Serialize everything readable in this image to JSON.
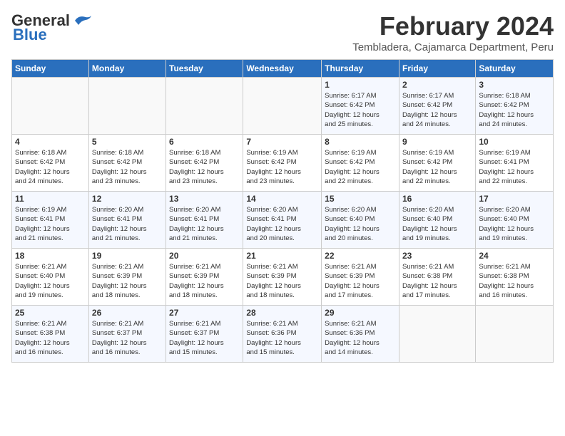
{
  "header": {
    "logo_general": "General",
    "logo_blue": "Blue",
    "month": "February 2024",
    "location": "Tembladera, Cajamarca Department, Peru"
  },
  "days_of_week": [
    "Sunday",
    "Monday",
    "Tuesday",
    "Wednesday",
    "Thursday",
    "Friday",
    "Saturday"
  ],
  "weeks": [
    [
      {
        "day": "",
        "info": ""
      },
      {
        "day": "",
        "info": ""
      },
      {
        "day": "",
        "info": ""
      },
      {
        "day": "",
        "info": ""
      },
      {
        "day": "1",
        "info": "Sunrise: 6:17 AM\nSunset: 6:42 PM\nDaylight: 12 hours\nand 25 minutes."
      },
      {
        "day": "2",
        "info": "Sunrise: 6:17 AM\nSunset: 6:42 PM\nDaylight: 12 hours\nand 24 minutes."
      },
      {
        "day": "3",
        "info": "Sunrise: 6:18 AM\nSunset: 6:42 PM\nDaylight: 12 hours\nand 24 minutes."
      }
    ],
    [
      {
        "day": "4",
        "info": "Sunrise: 6:18 AM\nSunset: 6:42 PM\nDaylight: 12 hours\nand 24 minutes."
      },
      {
        "day": "5",
        "info": "Sunrise: 6:18 AM\nSunset: 6:42 PM\nDaylight: 12 hours\nand 23 minutes."
      },
      {
        "day": "6",
        "info": "Sunrise: 6:18 AM\nSunset: 6:42 PM\nDaylight: 12 hours\nand 23 minutes."
      },
      {
        "day": "7",
        "info": "Sunrise: 6:19 AM\nSunset: 6:42 PM\nDaylight: 12 hours\nand 23 minutes."
      },
      {
        "day": "8",
        "info": "Sunrise: 6:19 AM\nSunset: 6:42 PM\nDaylight: 12 hours\nand 22 minutes."
      },
      {
        "day": "9",
        "info": "Sunrise: 6:19 AM\nSunset: 6:42 PM\nDaylight: 12 hours\nand 22 minutes."
      },
      {
        "day": "10",
        "info": "Sunrise: 6:19 AM\nSunset: 6:41 PM\nDaylight: 12 hours\nand 22 minutes."
      }
    ],
    [
      {
        "day": "11",
        "info": "Sunrise: 6:19 AM\nSunset: 6:41 PM\nDaylight: 12 hours\nand 21 minutes."
      },
      {
        "day": "12",
        "info": "Sunrise: 6:20 AM\nSunset: 6:41 PM\nDaylight: 12 hours\nand 21 minutes."
      },
      {
        "day": "13",
        "info": "Sunrise: 6:20 AM\nSunset: 6:41 PM\nDaylight: 12 hours\nand 21 minutes."
      },
      {
        "day": "14",
        "info": "Sunrise: 6:20 AM\nSunset: 6:41 PM\nDaylight: 12 hours\nand 20 minutes."
      },
      {
        "day": "15",
        "info": "Sunrise: 6:20 AM\nSunset: 6:40 PM\nDaylight: 12 hours\nand 20 minutes."
      },
      {
        "day": "16",
        "info": "Sunrise: 6:20 AM\nSunset: 6:40 PM\nDaylight: 12 hours\nand 19 minutes."
      },
      {
        "day": "17",
        "info": "Sunrise: 6:20 AM\nSunset: 6:40 PM\nDaylight: 12 hours\nand 19 minutes."
      }
    ],
    [
      {
        "day": "18",
        "info": "Sunrise: 6:21 AM\nSunset: 6:40 PM\nDaylight: 12 hours\nand 19 minutes."
      },
      {
        "day": "19",
        "info": "Sunrise: 6:21 AM\nSunset: 6:39 PM\nDaylight: 12 hours\nand 18 minutes."
      },
      {
        "day": "20",
        "info": "Sunrise: 6:21 AM\nSunset: 6:39 PM\nDaylight: 12 hours\nand 18 minutes."
      },
      {
        "day": "21",
        "info": "Sunrise: 6:21 AM\nSunset: 6:39 PM\nDaylight: 12 hours\nand 18 minutes."
      },
      {
        "day": "22",
        "info": "Sunrise: 6:21 AM\nSunset: 6:39 PM\nDaylight: 12 hours\nand 17 minutes."
      },
      {
        "day": "23",
        "info": "Sunrise: 6:21 AM\nSunset: 6:38 PM\nDaylight: 12 hours\nand 17 minutes."
      },
      {
        "day": "24",
        "info": "Sunrise: 6:21 AM\nSunset: 6:38 PM\nDaylight: 12 hours\nand 16 minutes."
      }
    ],
    [
      {
        "day": "25",
        "info": "Sunrise: 6:21 AM\nSunset: 6:38 PM\nDaylight: 12 hours\nand 16 minutes."
      },
      {
        "day": "26",
        "info": "Sunrise: 6:21 AM\nSunset: 6:37 PM\nDaylight: 12 hours\nand 16 minutes."
      },
      {
        "day": "27",
        "info": "Sunrise: 6:21 AM\nSunset: 6:37 PM\nDaylight: 12 hours\nand 15 minutes."
      },
      {
        "day": "28",
        "info": "Sunrise: 6:21 AM\nSunset: 6:36 PM\nDaylight: 12 hours\nand 15 minutes."
      },
      {
        "day": "29",
        "info": "Sunrise: 6:21 AM\nSunset: 6:36 PM\nDaylight: 12 hours\nand 14 minutes."
      },
      {
        "day": "",
        "info": ""
      },
      {
        "day": "",
        "info": ""
      }
    ]
  ]
}
